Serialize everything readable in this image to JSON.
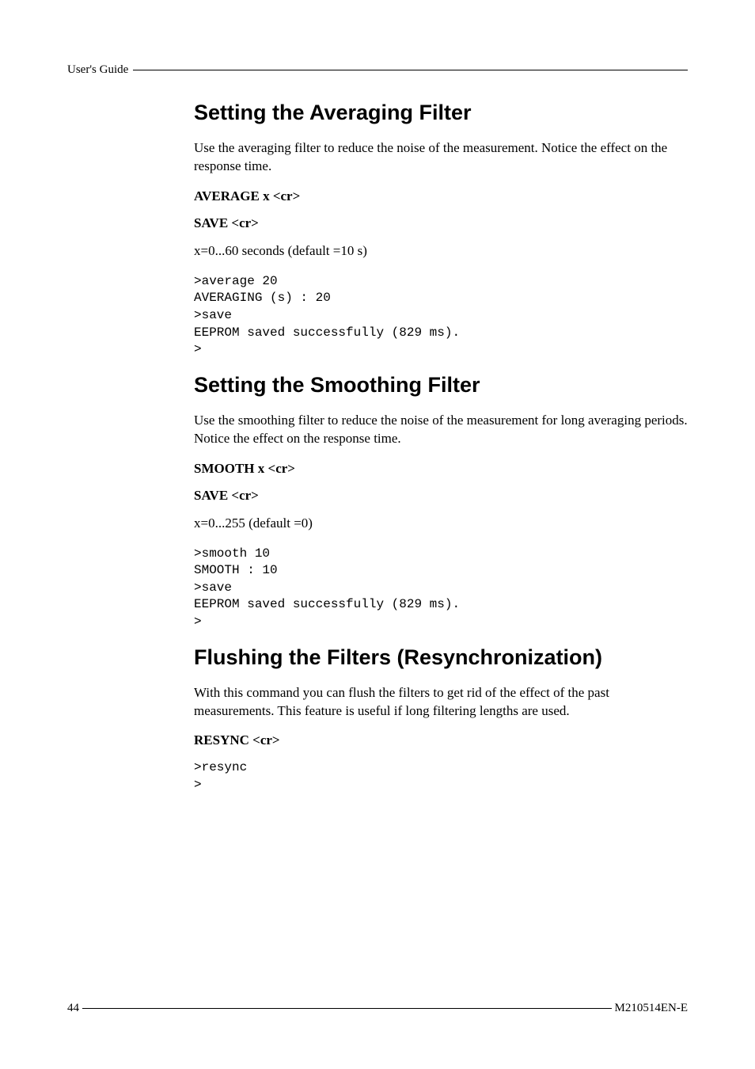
{
  "header": {
    "label": "User's Guide"
  },
  "sections": {
    "averaging": {
      "title": "Setting the Averaging Filter",
      "intro": "Use the averaging filter to reduce the noise of the measurement. Notice the effect on the response time.",
      "cmd1": "AVERAGE x <cr>",
      "cmd2": "SAVE <cr>",
      "range": "x=0...60 seconds (default =10 s)",
      "code": ">average 20\nAVERAGING (s) : 20\n>save\nEEPROM saved successfully (829 ms).\n>"
    },
    "smoothing": {
      "title": "Setting the Smoothing Filter",
      "intro": "Use the smoothing filter to reduce the noise of the measurement for long averaging periods. Notice the effect on the response time.",
      "cmd1": "SMOOTH x <cr>",
      "cmd2": "SAVE <cr>",
      "range": "x=0...255 (default =0)",
      "code": ">smooth 10\nSMOOTH : 10\n>save\nEEPROM saved successfully (829 ms).\n>"
    },
    "flushing": {
      "title": "Flushing the Filters (Resynchronization)",
      "intro": "With this command you can flush the filters to get rid of the effect of the past measurements. This feature is useful if long filtering lengths are used.",
      "cmd1": "RESYNC <cr>",
      "code": ">resync\n>"
    }
  },
  "footer": {
    "page": "44",
    "doc": "M210514EN-E"
  }
}
